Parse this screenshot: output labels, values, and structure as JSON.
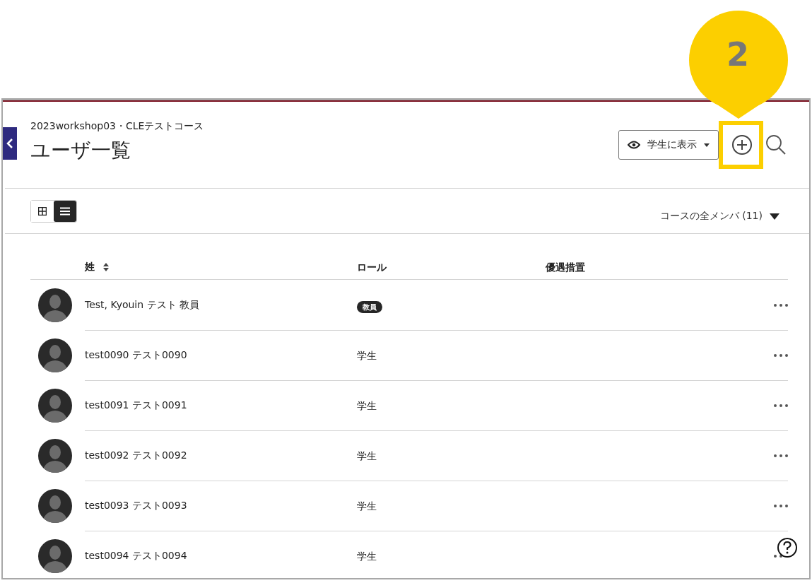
{
  "callout": {
    "number": "2"
  },
  "header": {
    "breadcrumb": "2023workshop03・CLEテストコース",
    "title": "ユーザ一覧",
    "view_button": "学生に表示"
  },
  "view_toggle": [
    {
      "kind": "grid",
      "selected": false
    },
    {
      "kind": "list",
      "selected": true
    }
  ],
  "filter": "コースの全メンバ (11)",
  "table": {
    "columns": [
      "姓",
      "ロール",
      "優遇措置"
    ],
    "rows": [
      {
        "name": "Test, Kyouin テスト 教員",
        "role": "教員",
        "kind": "badge"
      },
      {
        "name": "test0090 テスト0090",
        "role": "学生",
        "kind": "text"
      },
      {
        "name": "test0091 テスト0091",
        "role": "学生",
        "kind": "text"
      },
      {
        "name": "test0092 テスト0092",
        "role": "学生",
        "kind": "text"
      },
      {
        "name": "test0093 テスト0093",
        "role": "学生",
        "kind": "text"
      },
      {
        "name": "test0094 テスト0094",
        "role": "学生",
        "kind": "text"
      }
    ]
  }
}
